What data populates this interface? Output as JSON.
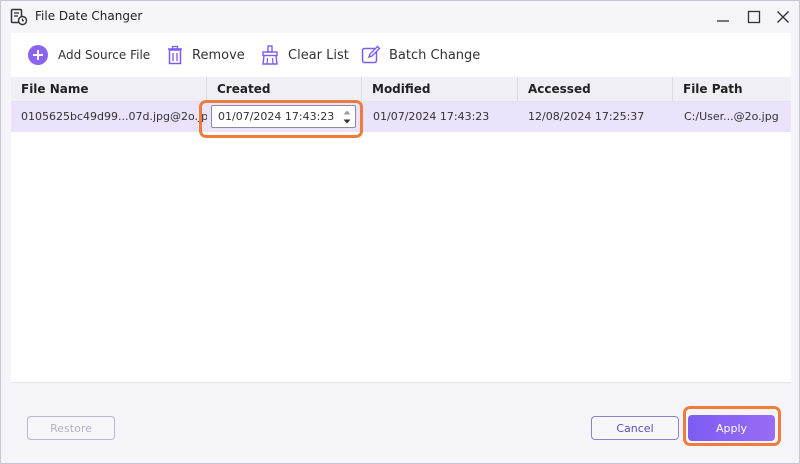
{
  "window": {
    "title": "File Date Changer"
  },
  "toolbar": {
    "add_label": "Add Source File",
    "remove_label": "Remove",
    "clear_label": "Clear List",
    "batch_label": "Batch Change"
  },
  "table": {
    "columns": [
      "File Name",
      "Created",
      "Modified",
      "Accessed",
      "File Path"
    ],
    "rows": [
      {
        "file_name": "0105625bc49d99...07d.jpg@2o.jpg",
        "created": "01/07/2024 17:43:23",
        "modified": "01/07/2024 17:43:23",
        "accessed": "12/08/2024 17:25:37",
        "file_path": "C:/User...@2o.jpg"
      }
    ]
  },
  "footer": {
    "restore_label": "Restore",
    "cancel_label": "Cancel",
    "apply_label": "Apply"
  },
  "colors": {
    "accent": "#8a63f3",
    "highlight": "#f07c3c",
    "selected_row": "#eae3fb"
  }
}
